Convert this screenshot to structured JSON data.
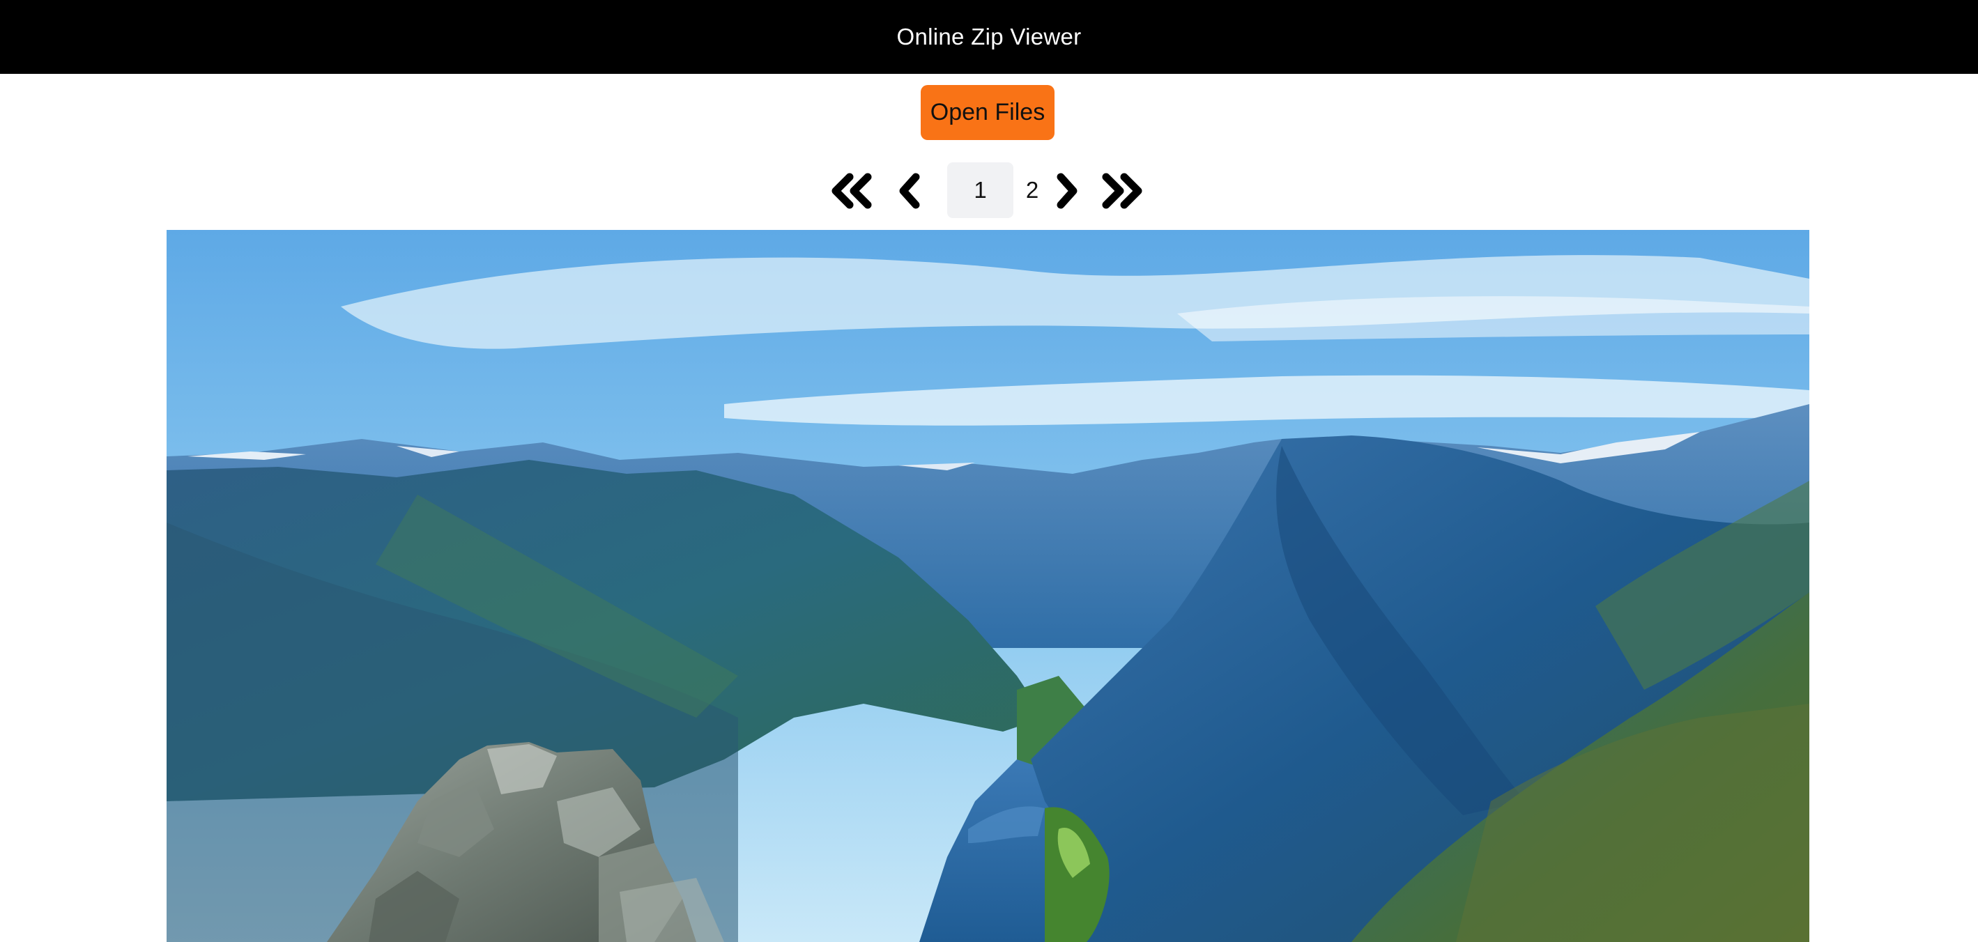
{
  "header": {
    "title": "Online Zip Viewer"
  },
  "toolbar": {
    "open_label": "Open Files",
    "accent_color": "#f97316"
  },
  "pagination": {
    "first_icon": "double-chevron-left-icon",
    "prev_icon": "chevron-left-icon",
    "next_icon": "chevron-right-icon",
    "last_icon": "double-chevron-right-icon",
    "pages": [
      "1",
      "2"
    ],
    "current_page": "1"
  },
  "viewer": {
    "content": "fjord-landscape-photo"
  }
}
